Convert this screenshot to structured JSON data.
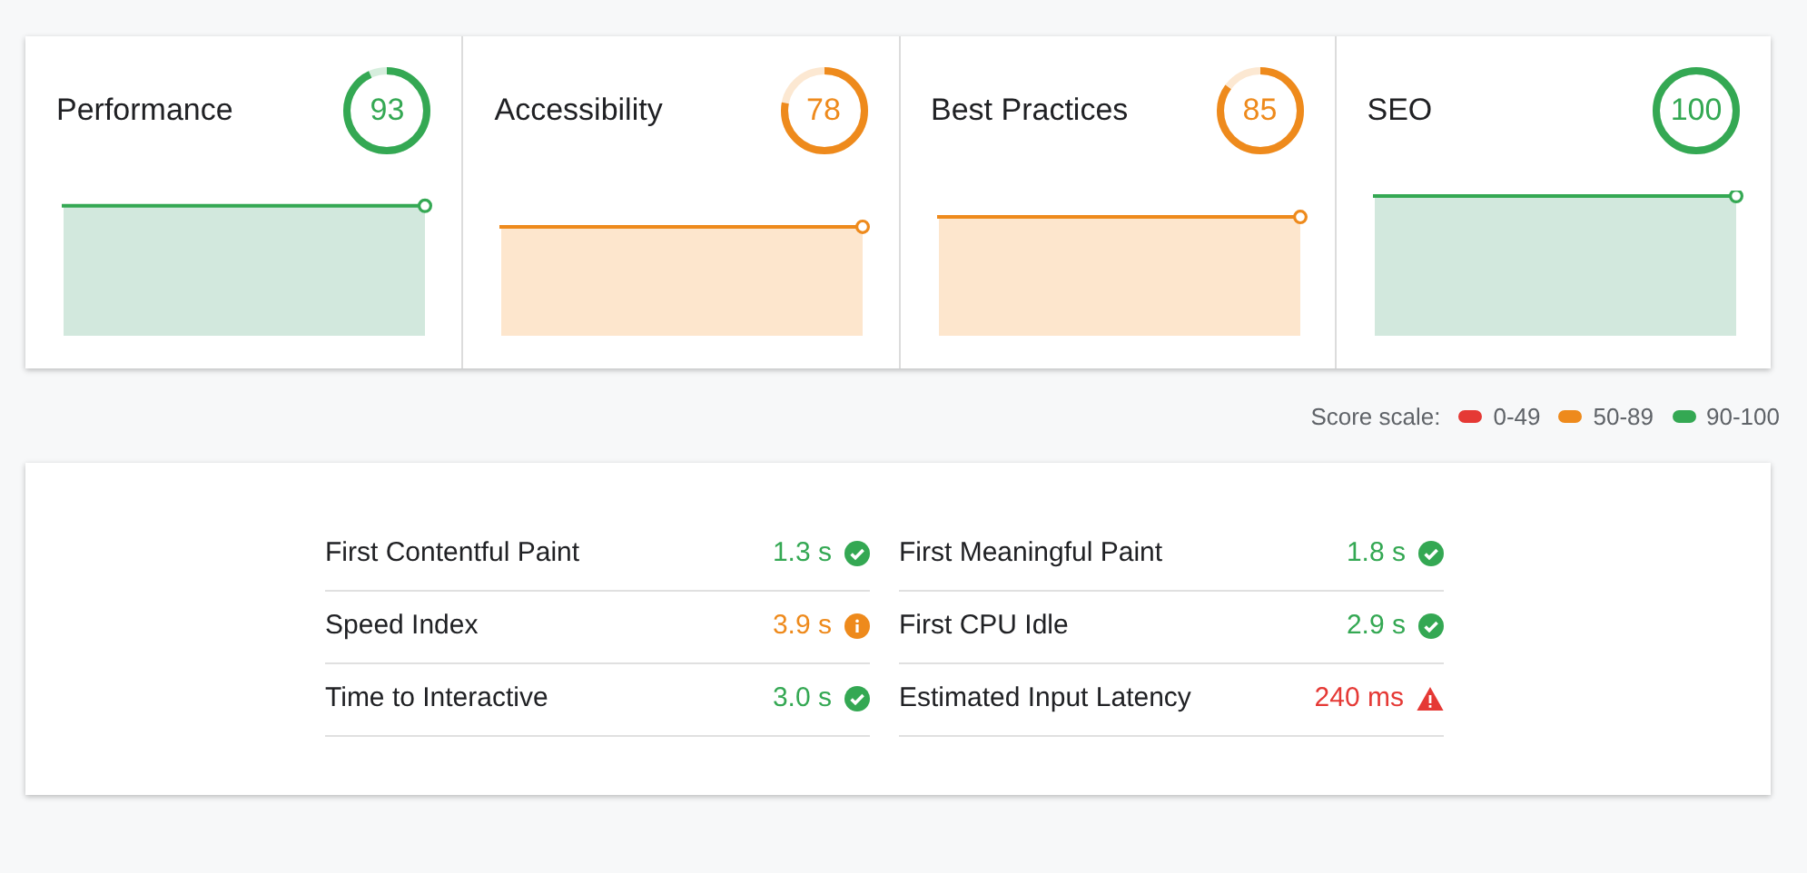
{
  "categories": [
    {
      "title": "Performance",
      "score": "93",
      "color": "#34a853"
    },
    {
      "title": "Accessibility",
      "score": "78",
      "color": "#ee8a1c"
    },
    {
      "title": "Best Practices",
      "score": "85",
      "color": "#ee8a1c"
    },
    {
      "title": "SEO",
      "score": "100",
      "color": "#34a853"
    }
  ],
  "score_scale": {
    "label": "Score scale:",
    "ranges": [
      {
        "label": "0-49",
        "color": "#e53935"
      },
      {
        "label": "50-89",
        "color": "#ee8a1c"
      },
      {
        "label": "90-100",
        "color": "#34a853"
      }
    ]
  },
  "metrics": [
    {
      "name": "First Contentful Paint",
      "value": "1.3 s",
      "kind": "pass"
    },
    {
      "name": "First Meaningful Paint",
      "value": "1.8 s",
      "kind": "pass"
    },
    {
      "name": "Speed Index",
      "value": "3.9 s",
      "kind": "average"
    },
    {
      "name": "First CPU Idle",
      "value": "2.9 s",
      "kind": "pass"
    },
    {
      "name": "Time to Interactive",
      "value": "3.0 s",
      "kind": "pass"
    },
    {
      "name": "Estimated Input Latency",
      "value": "240 ms",
      "kind": "fail"
    }
  ]
}
